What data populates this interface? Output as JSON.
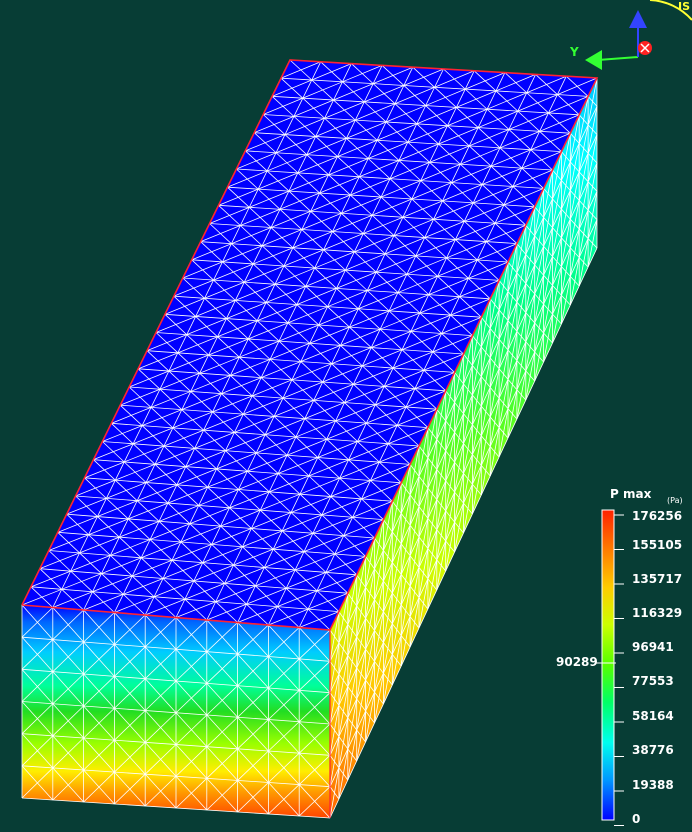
{
  "legend": {
    "title": "P max",
    "unit": "(Pa)",
    "ticks": [
      "176256",
      "155105",
      "135717",
      "116329",
      "96941",
      "77553",
      "58164",
      "38776",
      "19388",
      "0"
    ],
    "cursor_value": "90289",
    "colors": [
      "#0000ff",
      "#0077ff",
      "#00ccff",
      "#00ffcc",
      "#00ff66",
      "#66ff00",
      "#ccff00",
      "#ffff00",
      "#ffcc00",
      "#ff8800",
      "#ff3300"
    ]
  },
  "triad": {
    "y_label": "Y",
    "corner_label": "IS"
  },
  "scene": {
    "background": "#073d35",
    "top_face_color": "#0000ff",
    "mesh_line_color": "#ffffff",
    "edge_color": "#ff2233"
  }
}
